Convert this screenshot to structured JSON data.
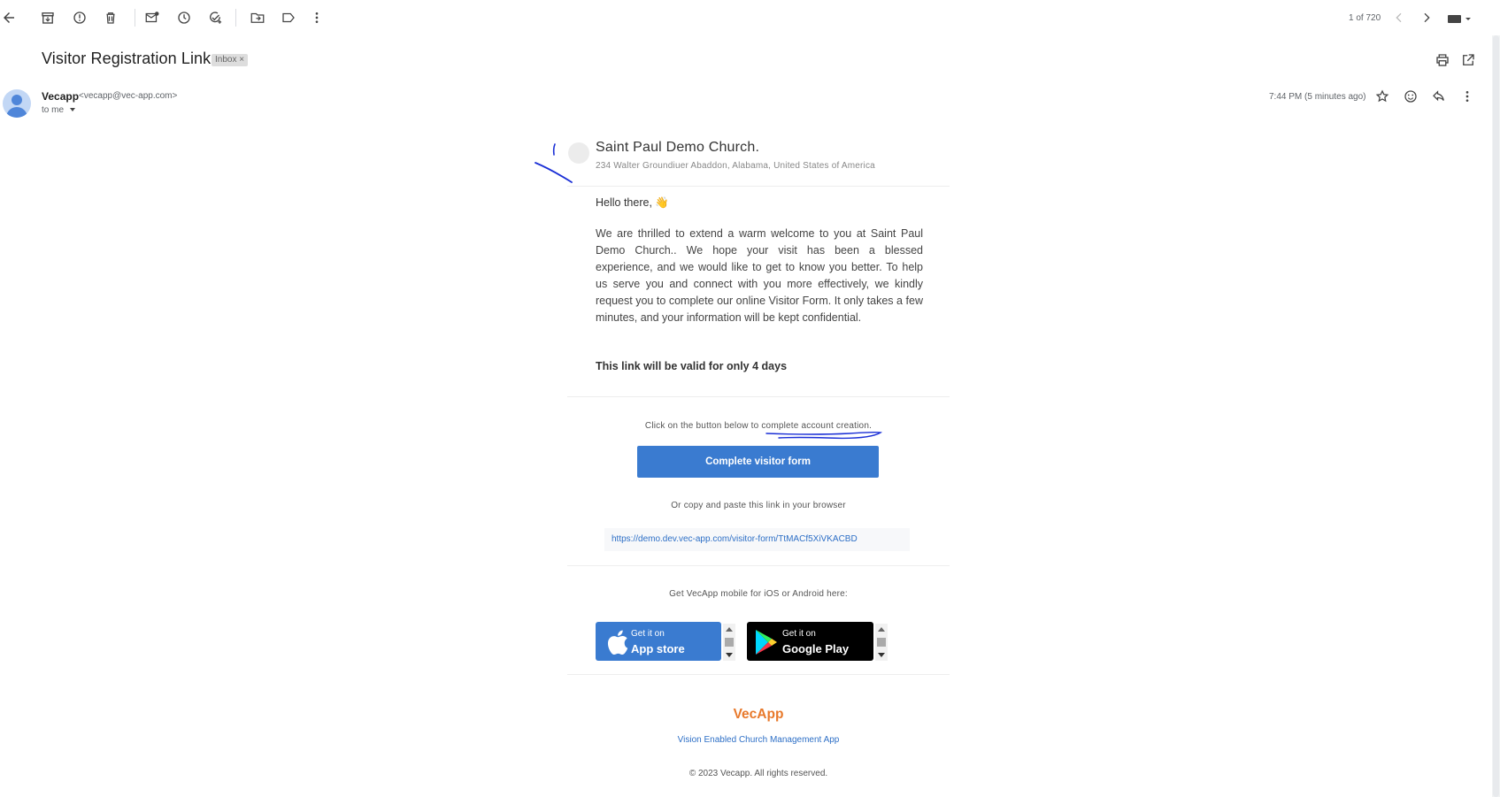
{
  "toolbar": {
    "icons": [
      "back-arrow-icon",
      "archive-icon",
      "report-spam-icon",
      "delete-icon",
      "mark-unread-icon",
      "snooze-icon",
      "add-to-tasks-icon",
      "move-to-icon",
      "label-icon",
      "more-icon"
    ],
    "pager_text": "1 of 720",
    "right_icons": [
      "newer-icon",
      "older-icon",
      "keyboard-icon"
    ]
  },
  "message": {
    "subject": "Visitor Registration Link",
    "label_badge": "Inbox",
    "label_close": "×",
    "sender_name": "Vecapp",
    "sender_email": "<vecapp@vec-app.com>",
    "recipient": "to me",
    "timestamp": "7:44 PM (5 minutes ago)"
  },
  "email": {
    "church_name": "Saint Paul Demo Church.",
    "church_address": "234 Walter Groundiuer Abaddon, Alabama, United States of America",
    "greeting": "Hello there, 👋",
    "body": "We are thrilled to extend a warm welcome to you at Saint Paul Demo Church.. We hope your visit has been a blessed experience, and we would like to get to know you better. To help us serve you and connect with you more effectively, we kindly request you to complete our online Visitor Form. It only takes a few minutes, and your information will be kept confidential.",
    "validity": "This link will be valid for only 4 days",
    "click_instruction": "Click on the button below to complete account creation.",
    "button_label": "Complete visitor form",
    "copy_instruction": "Or copy and paste this link in your browser",
    "link": "https://demo.dev.vec-app.com/visitor-form/TtMACf5XiVKACBD",
    "mobile_text": "Get VecApp mobile for iOS or Android here:",
    "appstore_small": "Get it on",
    "appstore_big": "App store",
    "googleplay_small": "Get it on",
    "googleplay_big": "Google Play",
    "brand": "VecApp",
    "tagline": "Vision Enabled Church Management App",
    "copyright": "© 2023 Vecapp. All rights reserved."
  },
  "colors": {
    "accent_blue": "#3a7bd0",
    "link_blue": "#2d6fc6",
    "brand_orange": "#e8792b",
    "annotation_ink": "#1a2fd6"
  }
}
